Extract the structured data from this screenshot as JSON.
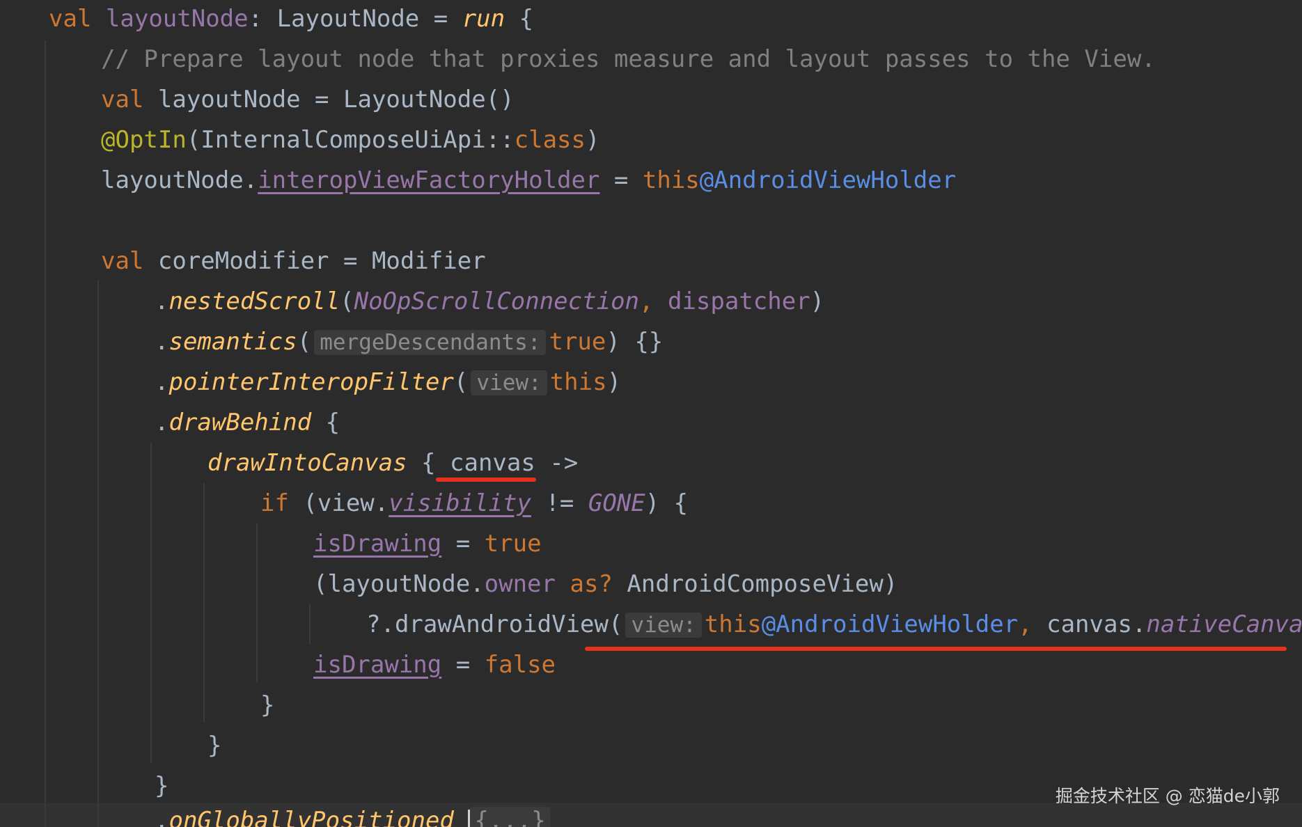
{
  "code": {
    "l1": {
      "kw": "val",
      "name": "layoutNode",
      "colon": ": ",
      "type": "LayoutNode",
      "eq": " = ",
      "fn": "run",
      "brace": " {"
    },
    "l2": {
      "comment": "// Prepare layout node that proxies measure and layout passes to the View."
    },
    "l3": {
      "kw": "val",
      "rest": " layoutNode = LayoutNode()"
    },
    "l4": {
      "ann": "@OptIn",
      "open": "(InternalComposeUiApi::",
      "kw": "class",
      "close": ")"
    },
    "l5": {
      "recv": "layoutNode.",
      "prop": "interopViewFactoryHolder",
      "eq": " = ",
      "this_kw": "this",
      "label": "@AndroidViewHolder"
    },
    "l7": {
      "kw": "val",
      "rest": " coreModifier = Modifier"
    },
    "l8": {
      "dot": ".",
      "fn": "nestedScroll",
      "open": "(",
      "arg1": "NoOpScrollConnection",
      "comma": ", ",
      "arg2": "dispatcher",
      "close": ")"
    },
    "l9": {
      "dot": ".",
      "fn": "semantics",
      "open": "(",
      "hint": "mergeDescendants:",
      "value": "true",
      "rest": ") {}"
    },
    "l10": {
      "dot": ".",
      "fn": "pointerInteropFilter",
      "open": "(",
      "hint": "view:",
      "value": "this",
      "close": ")"
    },
    "l11": {
      "dot": ".",
      "fn": "drawBehind",
      "rest": " {"
    },
    "l12": {
      "fn": "drawIntoCanvas",
      "brace": " { ",
      "param": "canvas",
      "arrow": " ->"
    },
    "l13": {
      "kw": "if",
      "open": " (view.",
      "prop": "visibility",
      "op": " != ",
      "const": "GONE",
      "rest": ") {"
    },
    "l14": {
      "prop": "isDrawing",
      "eq": " = ",
      "value": "true"
    },
    "l15": {
      "open": "(layoutNode.",
      "prop": "owner",
      "sp": " ",
      "kw": "as?",
      "rest": " AndroidComposeView)"
    },
    "l16": {
      "call": "?.drawAndroidView(",
      "hint": "view:",
      "this_kw": "this",
      "label": "@AndroidViewHolder",
      "comma": ", ",
      "recv": "canvas.",
      "prop": "nativeCanvas",
      "close": ")"
    },
    "l17": {
      "prop": "isDrawing",
      "eq": " = ",
      "value": "false"
    },
    "l18": {
      "brace": "}"
    },
    "l19": {
      "brace": "}"
    },
    "l20": {
      "brace": "}"
    },
    "l21": {
      "dot": ".",
      "fn": "onGloballyPositioned",
      "sp": " ",
      "fold": "{...}"
    }
  },
  "watermark": "掘金技术社区 @ 恋猫de小郭",
  "colors": {
    "background": "#2b2b2b",
    "keyword": "#cc7832",
    "function": "#ffc66d",
    "property": "#9876aa",
    "comment": "#808080",
    "annotation": "#bbb529",
    "label": "#5a8ee6",
    "highlight_underline": "#e8311b"
  }
}
